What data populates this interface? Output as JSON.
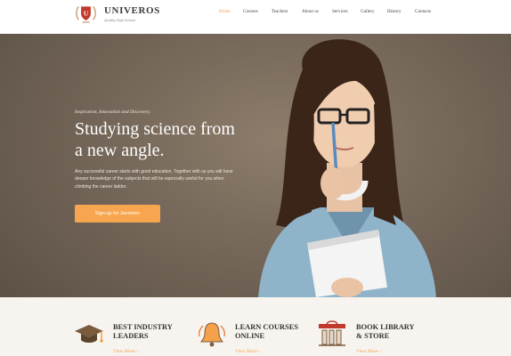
{
  "brand": {
    "name": "UNIVEROS",
    "tagline": "Quality High School",
    "logo_icon": "shield-laurel-icon",
    "accent_color": "#f5a04a"
  },
  "nav": {
    "items": [
      {
        "label": "Home",
        "active": true
      },
      {
        "label": "Courses"
      },
      {
        "label": "Teachers"
      },
      {
        "label": "About us"
      },
      {
        "label": "Services"
      },
      {
        "label": "Gallery"
      },
      {
        "label": "History"
      },
      {
        "label": "Contacts"
      }
    ]
  },
  "hero": {
    "kicker": "Inspiration, Innovation and Discovery.",
    "title_lines": [
      "Studying science from",
      "a new angle."
    ],
    "description_lines": [
      "Any successful career starts with good education. Together with us you will have",
      "deeper knowledge of the subjects that will be especially useful for you when",
      "climbing the career ladder."
    ],
    "cta_label": "Sign up for Jacomen",
    "button_color": "#f7a64f"
  },
  "features": [
    {
      "icon": "graduation-cap-icon",
      "title_lines": [
        "BEST INDUSTRY",
        "LEADERS"
      ],
      "link": "View More  ›"
    },
    {
      "icon": "bell-icon",
      "title_lines": [
        "LEARN COURSES",
        "ONLINE"
      ],
      "link": "View More  ›"
    },
    {
      "icon": "books-icon",
      "title_lines": [
        "BOOK LIBRARY",
        "& STORE"
      ],
      "link": "View More  ›"
    }
  ]
}
